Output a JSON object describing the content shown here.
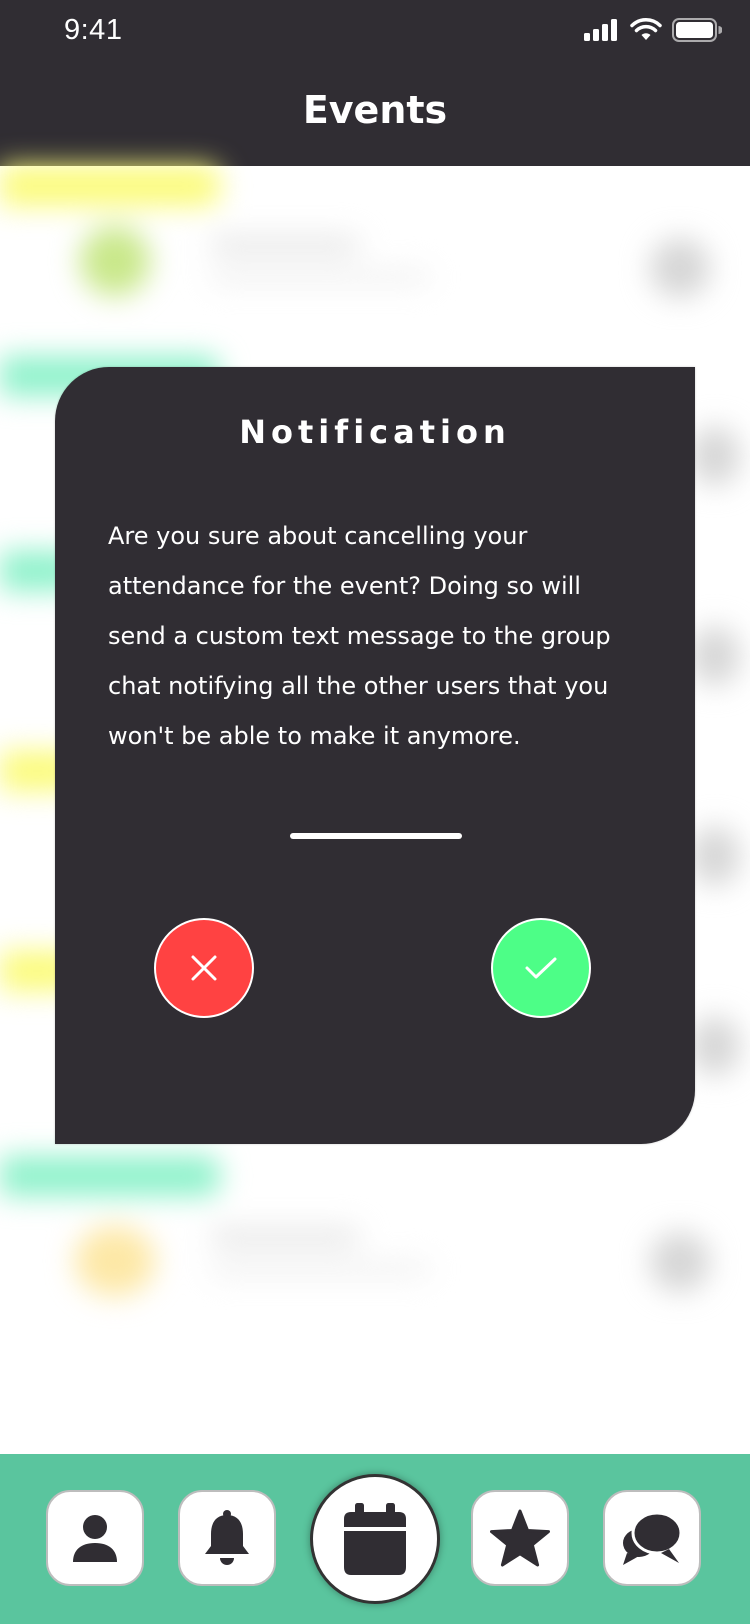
{
  "status_bar": {
    "time": "9:41"
  },
  "header": {
    "title": "Events"
  },
  "modal": {
    "title": "Notification",
    "message": "Are you sure about cancelling your attendance for the event? Doing so will send a custom text message to the group chat notifying all the other users that you won't be able to make it anymore.",
    "cancel_icon": "close-icon",
    "confirm_icon": "check-icon"
  },
  "tabbar": {
    "items": [
      {
        "icon": "profile-icon",
        "selected": false
      },
      {
        "icon": "bell-icon",
        "selected": false
      },
      {
        "icon": "calendar-icon",
        "selected": true
      },
      {
        "icon": "star-icon",
        "selected": false
      },
      {
        "icon": "chat-icon",
        "selected": false
      }
    ]
  },
  "colors": {
    "header_bg": "#302d33",
    "modal_bg": "#302d33",
    "cancel": "#ff4242",
    "confirm": "#4dfe87",
    "tabbar_bg": "#5ac59e",
    "icon_dark": "#302d33"
  }
}
